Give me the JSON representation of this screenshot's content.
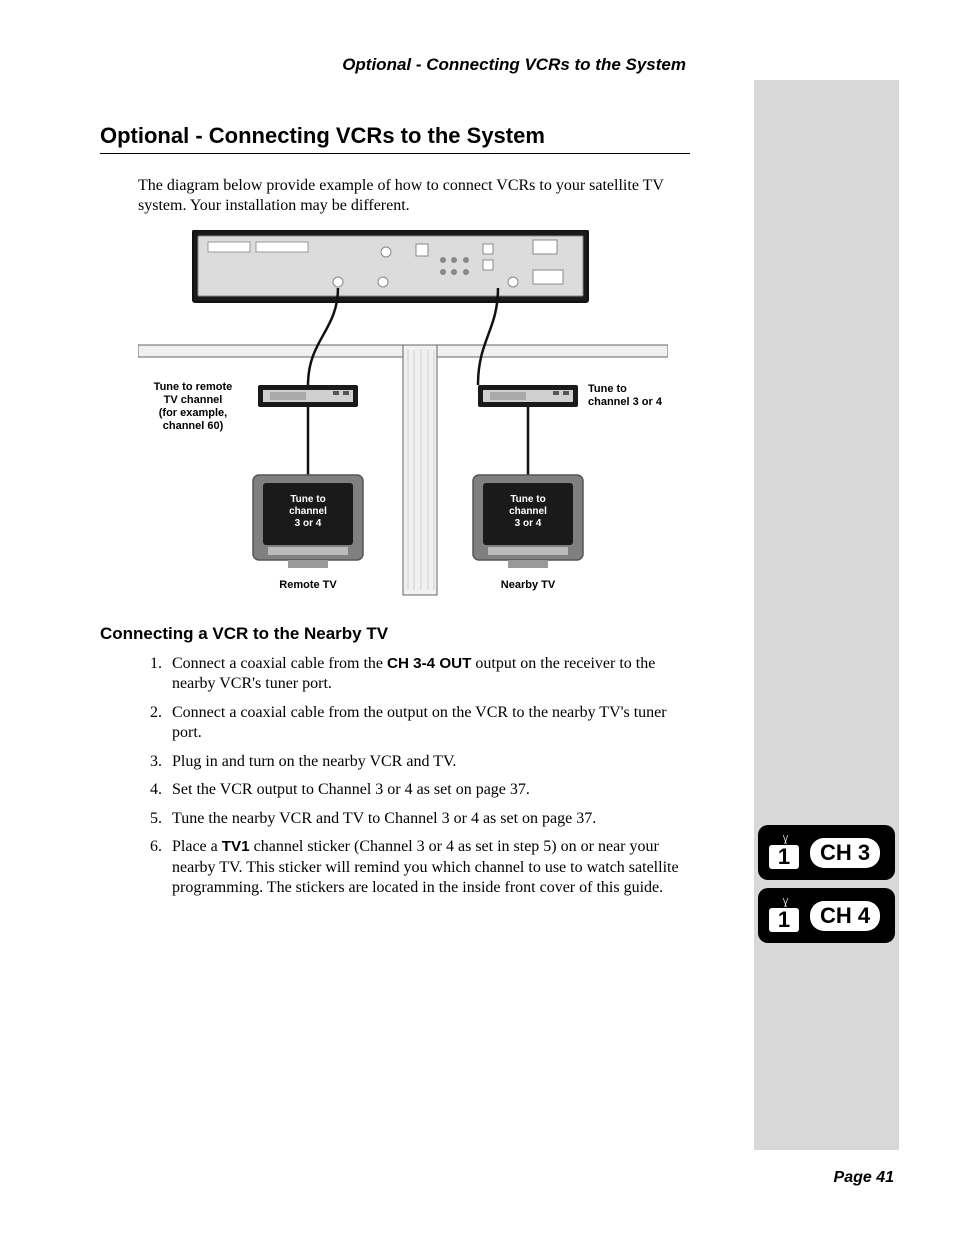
{
  "running_head": "Optional - Connecting VCRs to the System",
  "title": "Optional - Connecting VCRs to the System",
  "intro": "The diagram below provide example of how to connect VCRs to your satellite TV system. Your installation may be different.",
  "diagram": {
    "left_caption": [
      "Tune to remote",
      "TV channel",
      "(for example,",
      "channel 60)"
    ],
    "right_caption": [
      "Tune to",
      "channel 3 or 4"
    ],
    "tv_overlay": [
      "Tune to",
      "channel",
      "3 or 4"
    ],
    "remote_label": "Remote TV",
    "nearby_label": "Nearby TV"
  },
  "subhead": "Connecting a VCR to the Nearby TV",
  "steps": [
    {
      "pre": "Connect a coaxial cable from the ",
      "bold": "CH 3-4 OUT",
      "post": " output on the receiver to the nearby VCR's tuner port."
    },
    {
      "pre": "Connect a coaxial cable from the output on the VCR to the nearby TV's tuner port.",
      "bold": "",
      "post": ""
    },
    {
      "pre": "Plug in and turn on the nearby VCR and TV.",
      "bold": "",
      "post": ""
    },
    {
      "pre": "Set the VCR output to Channel 3 or 4 as set on page 37.",
      "bold": "",
      "post": ""
    },
    {
      "pre": "Tune the nearby VCR and TV to Channel 3 or 4 as set on page 37.",
      "bold": "",
      "post": ""
    },
    {
      "pre": "Place a ",
      "bold": "TV1",
      "post": " channel sticker (Channel 3 or 4 as set in step 5) on or near your nearby TV. This sticker will remind you which channel to use to watch satellite programming. The stickers are located in the inside front cover of this guide."
    }
  ],
  "badges": {
    "tv_num": "1",
    "ch_a": "CH 3",
    "ch_b": "CH 4"
  },
  "page_num": "Page 41"
}
